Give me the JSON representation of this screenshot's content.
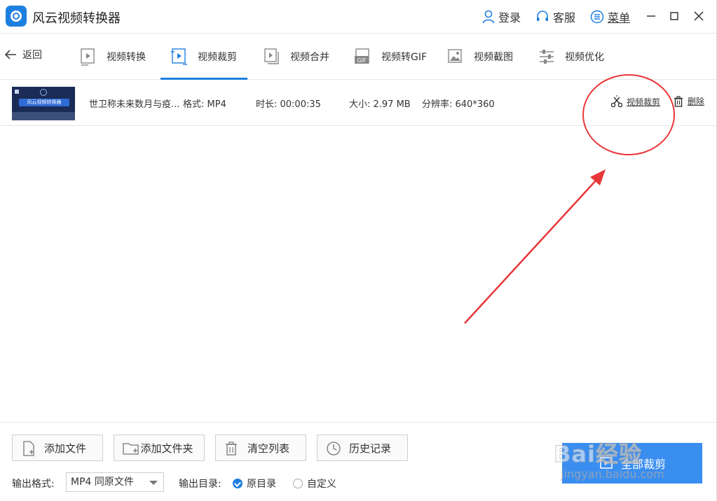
{
  "app": {
    "title": "风云视频转换器"
  },
  "titlebar": {
    "login": "登录",
    "service": "客服",
    "menu": "菜单"
  },
  "nav": {
    "back": "返回",
    "tabs": [
      {
        "label": "视频转换"
      },
      {
        "label": "视频裁剪"
      },
      {
        "label": "视频合并"
      },
      {
        "label": "视频转GIF",
        "badge": "GIF"
      },
      {
        "label": "视频截图"
      },
      {
        "label": "视频优化"
      }
    ],
    "active_tab": "视频裁剪"
  },
  "file": {
    "thumb_text": "风云视频转换器",
    "name": "世卫称未来数月与疫...",
    "format": "格式: MP4",
    "duration": "时长: 00:00:35",
    "size": "大小: 2.97 MB",
    "resolution": "分辨率: 640*360",
    "crop_action": "视频裁剪",
    "delete_action": "删除"
  },
  "footer": {
    "add_file": "添加文件",
    "add_folder": "添加文件夹",
    "clear_list": "清空列表",
    "history": "历史记录",
    "output_format_label": "输出格式:",
    "output_format_value": "MP4 同原文件",
    "output_dir_label": "输出目录:",
    "dir_options": [
      {
        "label": "原目录",
        "checked": true
      },
      {
        "label": "自定义",
        "checked": false
      }
    ],
    "start_button": "全部裁剪"
  },
  "watermark": {
    "main": "Bai经验",
    "sub": "jingyan.baidu.com"
  },
  "colors": {
    "accent": "#1e7fe0",
    "primary_button": "#3a8ef0",
    "annotation": "#e8373a"
  }
}
